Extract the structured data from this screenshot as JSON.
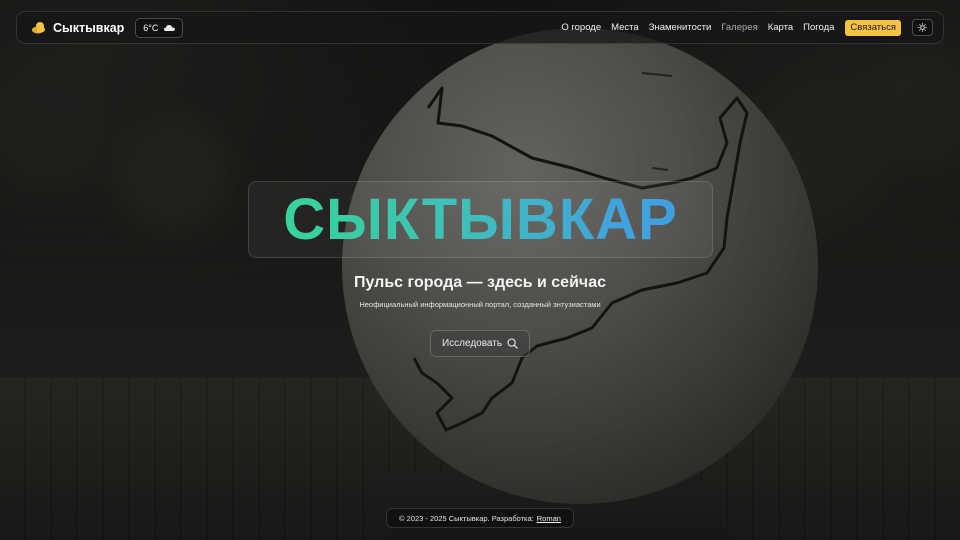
{
  "header": {
    "brand_name": "Сыктывкар",
    "weather": {
      "temperature": "6°C",
      "icon": "cloud-icon"
    },
    "nav": [
      {
        "label": "О городе",
        "active": false
      },
      {
        "label": "Места",
        "active": false
      },
      {
        "label": "Знаменитости",
        "active": false
      },
      {
        "label": "Галерея",
        "active": true
      },
      {
        "label": "Карта",
        "active": false
      },
      {
        "label": "Погода",
        "active": false
      }
    ],
    "contact_label": "Связаться",
    "theme_icon": "sun-icon"
  },
  "hero": {
    "title": "СЫКТЫВКАР",
    "subtitle": "Пульс города — здесь и сейчас",
    "note": "Неофициальный информационный портал, созданный энтузиастами",
    "explore_label": "Исследовать"
  },
  "footer": {
    "copyright": "© 2023 - 2025 Сыктывкар. Разработка:",
    "author": "Roman"
  },
  "colors": {
    "accent_yellow": "#f5c243",
    "title_gradient_start": "#37d39a",
    "title_gradient_end": "#3ea0e0"
  }
}
